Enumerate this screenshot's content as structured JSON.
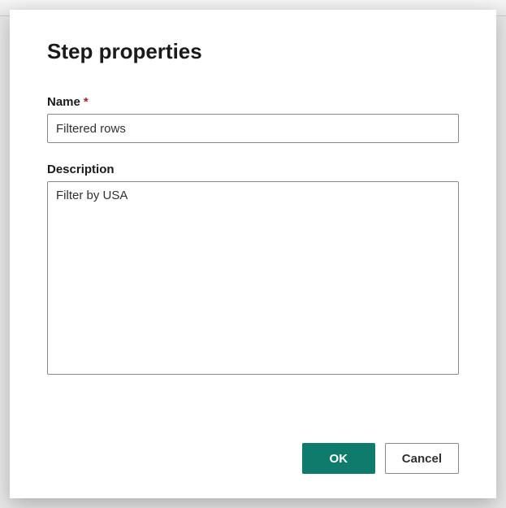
{
  "dialog": {
    "title": "Step properties",
    "fields": {
      "name": {
        "label": "Name",
        "required_mark": "*",
        "value": "Filtered rows"
      },
      "description": {
        "label": "Description",
        "value": "Filter by USA"
      }
    },
    "buttons": {
      "ok": "OK",
      "cancel": "Cancel"
    }
  }
}
